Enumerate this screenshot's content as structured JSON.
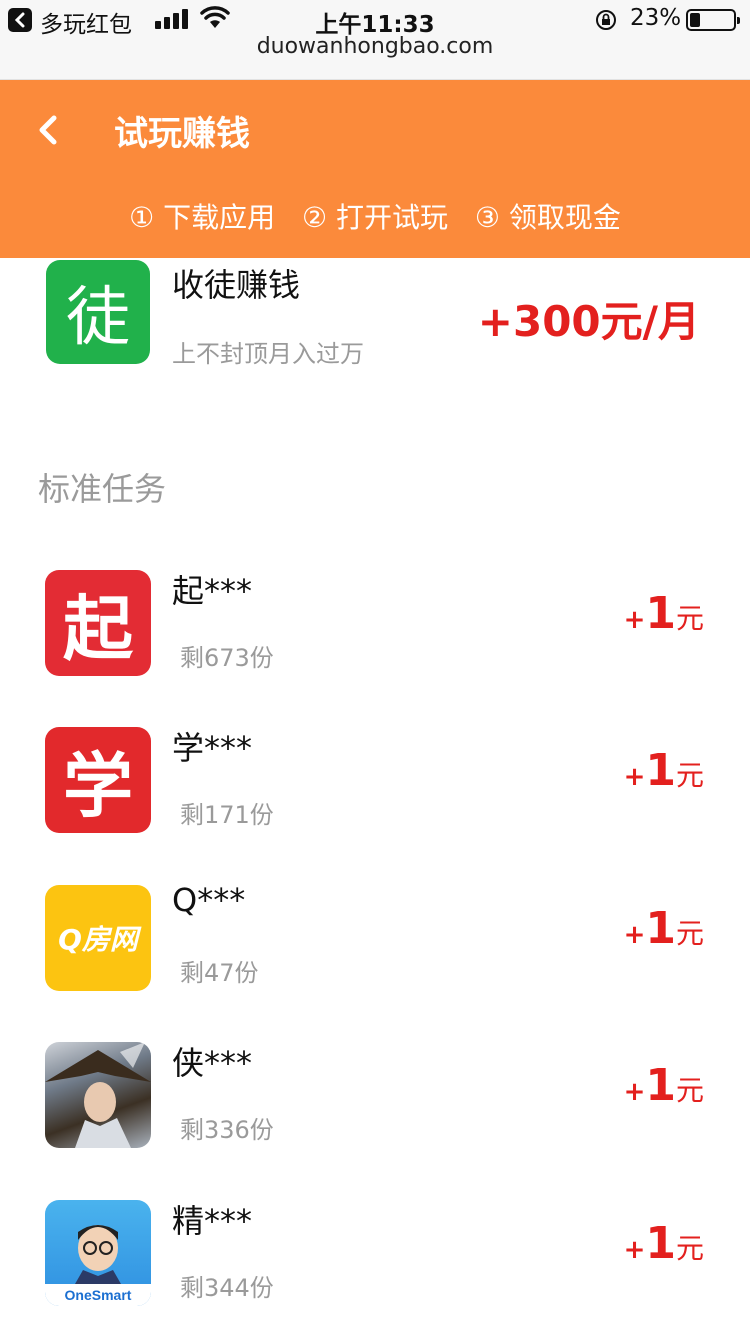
{
  "status_bar": {
    "app": "多玩红包",
    "time": "上午11:33",
    "battery": "23%",
    "battery_level": 0.23,
    "url": "duowanhongbao.com"
  },
  "header": {
    "title": "试玩赚钱",
    "steps": [
      "① 下载应用",
      "② 打开试玩",
      "③ 领取现金"
    ]
  },
  "featured": {
    "icon_text": "徒",
    "name": "收徒赚钱",
    "desc": "上不封顶月入过万",
    "reward": "+300元/月"
  },
  "section_title": "标准任务",
  "tasks": [
    {
      "name": "起***",
      "remain": "剩673份",
      "plus": "+",
      "amount": "1",
      "unit": "元",
      "icon_text": "起"
    },
    {
      "name": "学***",
      "remain": "剩171份",
      "plus": "+",
      "amount": "1",
      "unit": "元",
      "icon_text": "学"
    },
    {
      "name": "Q***",
      "remain": "剩47份",
      "plus": "+",
      "amount": "1",
      "unit": "元",
      "icon_text": "Q房网"
    },
    {
      "name": "侠***",
      "remain": "剩336份",
      "plus": "+",
      "amount": "1",
      "unit": "元"
    },
    {
      "name": "精***",
      "remain": "剩344份",
      "plus": "+",
      "amount": "1",
      "unit": "元",
      "icon_text": "OneSmart"
    }
  ]
}
